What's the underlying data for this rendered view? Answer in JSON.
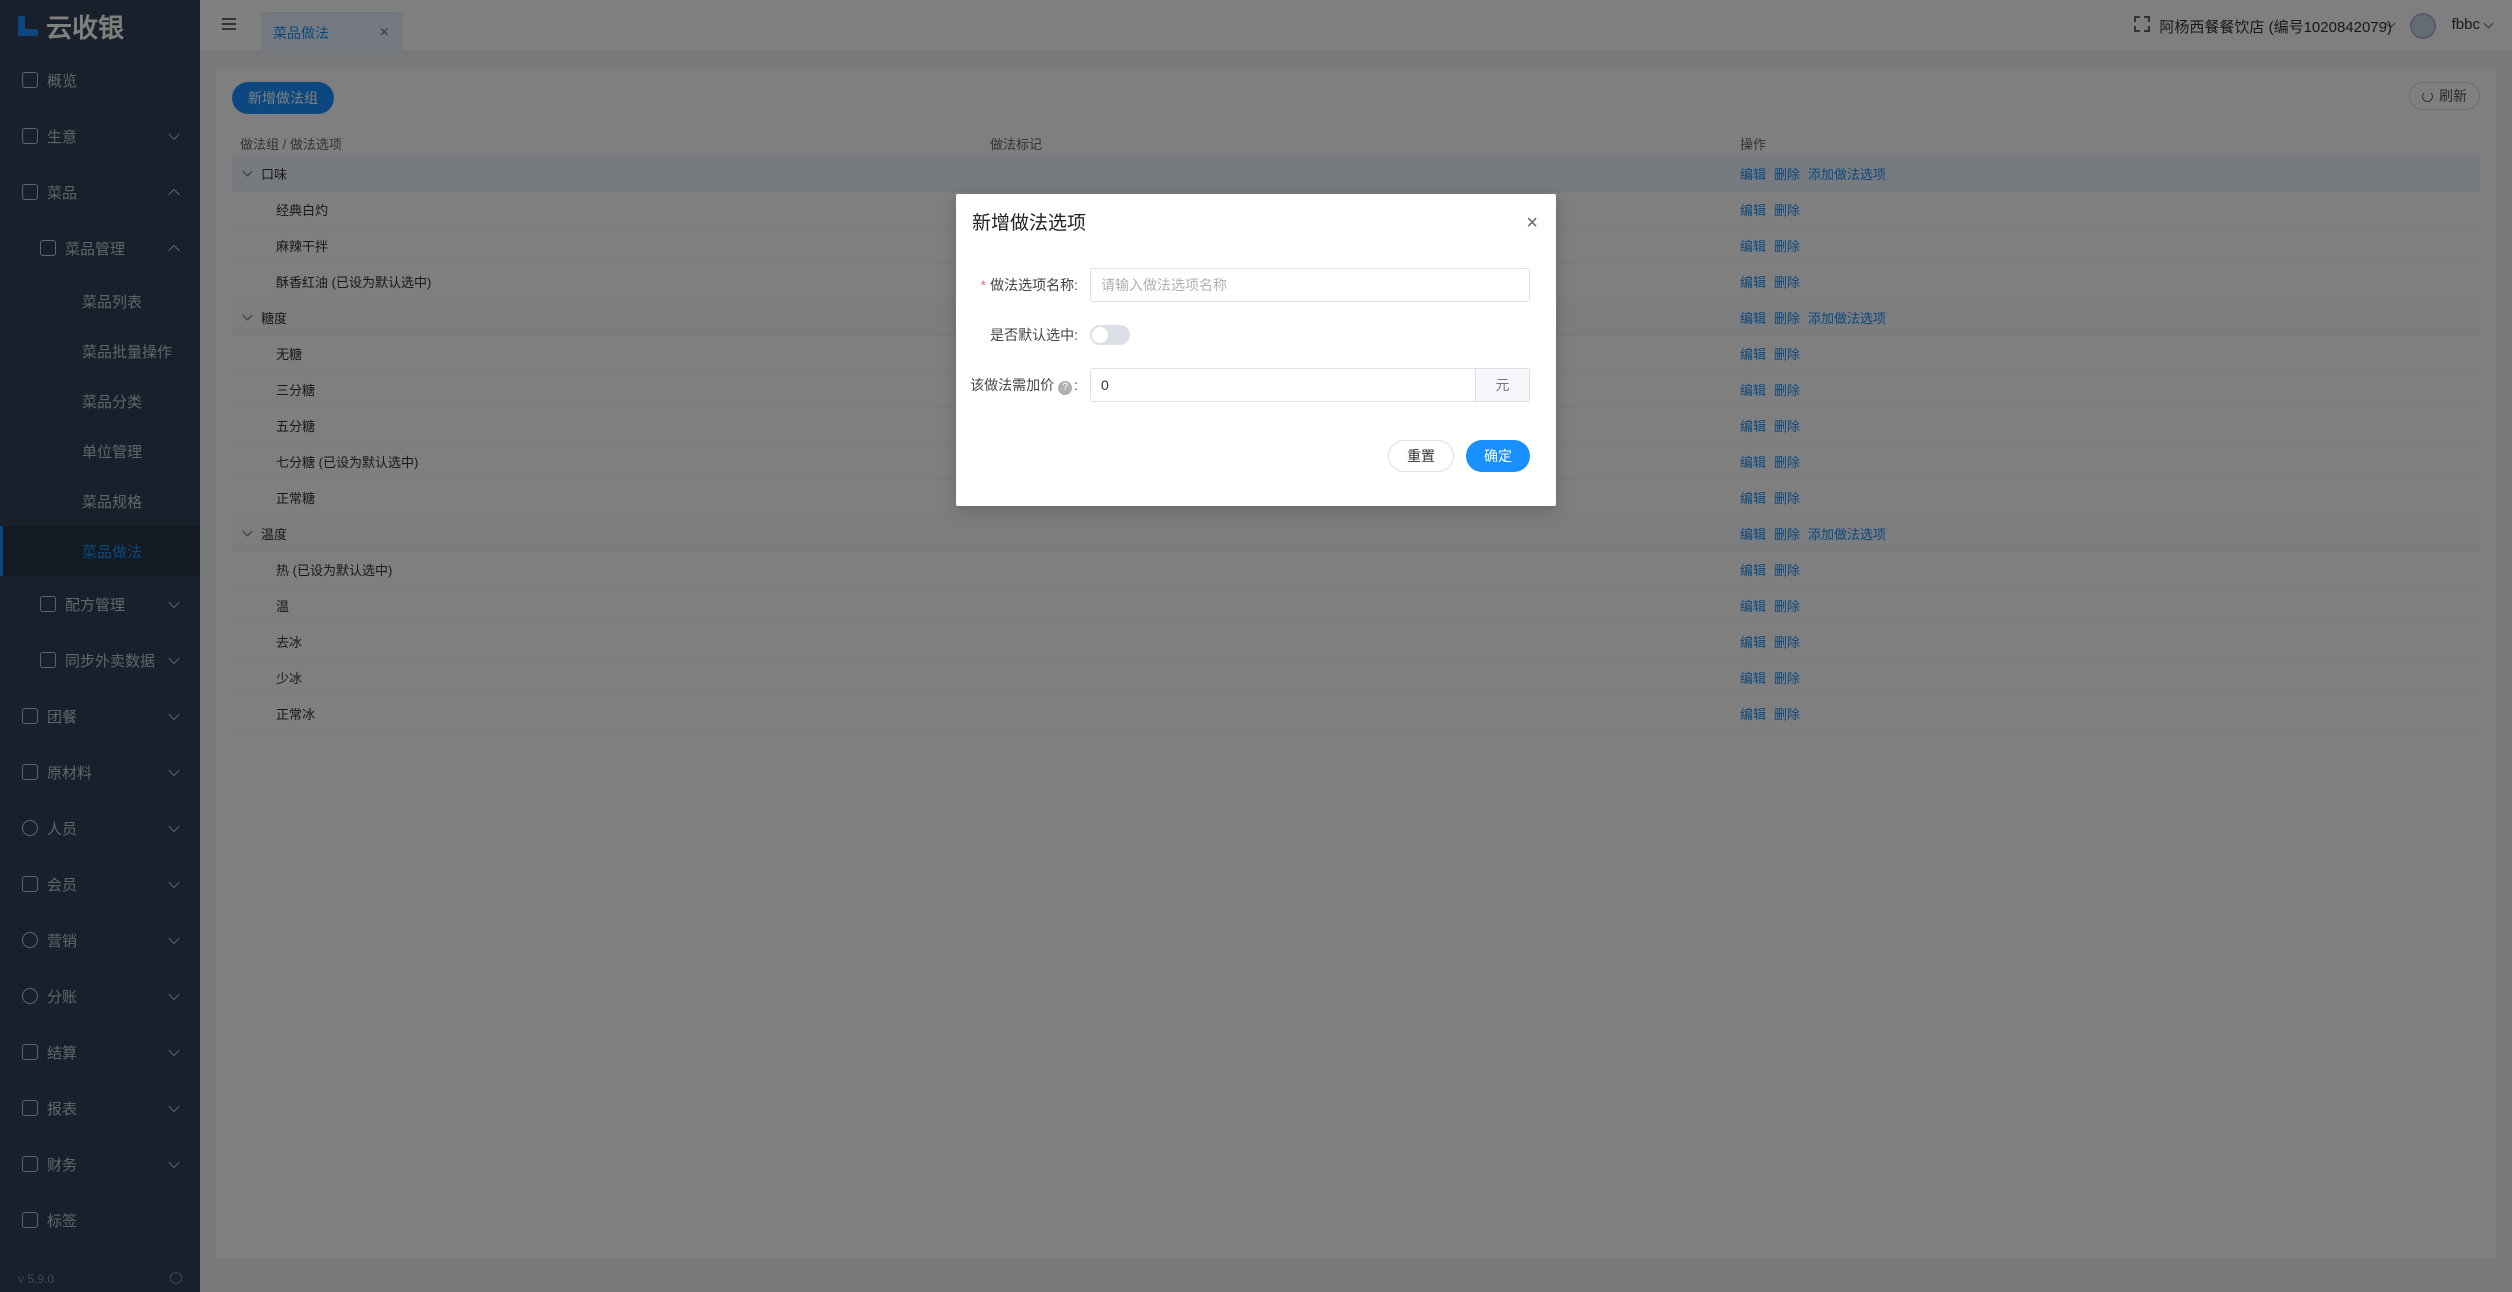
{
  "app": {
    "logo_text": "云收银",
    "version": "v 5.9.0"
  },
  "sidebar": {
    "items": [
      {
        "label": "概览"
      },
      {
        "label": "生意"
      },
      {
        "label": "菜品"
      },
      {
        "label": "菜品管理"
      },
      {
        "label": "菜品列表"
      },
      {
        "label": "菜品批量操作"
      },
      {
        "label": "菜品分类"
      },
      {
        "label": "单位管理"
      },
      {
        "label": "菜品规格"
      },
      {
        "label": "菜品做法"
      },
      {
        "label": "配方管理"
      },
      {
        "label": "同步外卖数据"
      },
      {
        "label": "团餐"
      },
      {
        "label": "原材料"
      },
      {
        "label": "人员"
      },
      {
        "label": "会员"
      },
      {
        "label": "营销"
      },
      {
        "label": "分账"
      },
      {
        "label": "结算"
      },
      {
        "label": "报表"
      },
      {
        "label": "财务"
      },
      {
        "label": "标签"
      }
    ]
  },
  "header": {
    "tab_label": "菜品做法",
    "tab_close": "×",
    "shop": "阿杨西餐餐饮店 (编号1020842079)",
    "username": "fbbc"
  },
  "toolbar": {
    "add_group_label": "新增做法组",
    "refresh_label": "刷新"
  },
  "table": {
    "headers": [
      "做法组 / 做法选项",
      "做法标记",
      "操作"
    ],
    "rows": [
      {
        "name": "口味",
        "group": true
      },
      {
        "name": "经典白灼",
        "group": false
      },
      {
        "name": "麻辣干拌",
        "group": false
      },
      {
        "name": "酥香红油 (已设为默认选中)",
        "group": false
      },
      {
        "name": "糖度",
        "group": true
      },
      {
        "name": "无糖",
        "group": false
      },
      {
        "name": "三分糖",
        "group": false
      },
      {
        "name": "五分糖",
        "group": false
      },
      {
        "name": "七分糖 (已设为默认选中)",
        "group": false
      },
      {
        "name": "正常糖",
        "group": false
      },
      {
        "name": "温度",
        "group": true
      },
      {
        "name": "热 (已设为默认选中)",
        "group": false
      },
      {
        "name": "温",
        "group": false
      },
      {
        "name": "去冰",
        "group": false
      },
      {
        "name": "少冰",
        "group": false
      },
      {
        "name": "正常冰",
        "group": false
      }
    ],
    "action_edit": "编辑",
    "action_delete": "删除",
    "action_add_option": "添加做法选项"
  },
  "modal": {
    "title": "新增做法选项",
    "close": "×",
    "name_label": "做法选项名称:",
    "name_required_mark": "*",
    "name_placeholder": "请输入做法选项名称",
    "name_value": "",
    "default_label": "是否默认选中:",
    "default_on": false,
    "price_label": "该做法需加价",
    "price_help": "?",
    "price_colon": ":",
    "price_value": "0",
    "price_unit": "元",
    "reset_label": "重置",
    "confirm_label": "确定"
  }
}
